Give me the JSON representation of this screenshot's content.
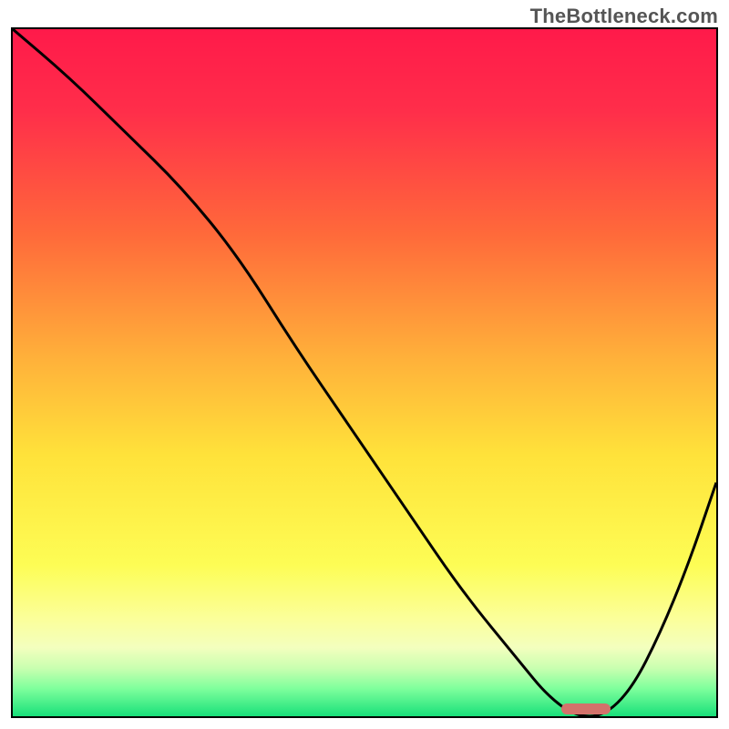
{
  "watermark": "TheBottleneck.com",
  "colors": {
    "gradient_stops": [
      {
        "pct": 0,
        "color": "#ff1a4a"
      },
      {
        "pct": 12,
        "color": "#ff2e4a"
      },
      {
        "pct": 30,
        "color": "#ff6a3a"
      },
      {
        "pct": 48,
        "color": "#ffb13a"
      },
      {
        "pct": 62,
        "color": "#ffe23a"
      },
      {
        "pct": 78,
        "color": "#fdfd55"
      },
      {
        "pct": 86,
        "color": "#fbff9c"
      },
      {
        "pct": 90,
        "color": "#f3ffbe"
      },
      {
        "pct": 93,
        "color": "#c9ffb0"
      },
      {
        "pct": 96,
        "color": "#7eff9c"
      },
      {
        "pct": 100,
        "color": "#18e07a"
      }
    ],
    "curve_stroke": "#000000",
    "marker_fill": "#d3726b"
  },
  "chart_data": {
    "type": "line",
    "title": "",
    "xlabel": "",
    "ylabel": "",
    "xlim": [
      0,
      100
    ],
    "ylim": [
      0,
      100
    ],
    "series": [
      {
        "name": "curve",
        "x": [
          0,
          8,
          16,
          24,
          32,
          40,
          48,
          56,
          64,
          72,
          76,
          80,
          84,
          88,
          92,
          96,
          100
        ],
        "y": [
          100,
          93,
          85,
          77,
          67,
          54,
          42,
          30,
          18,
          8,
          3,
          0,
          0,
          4,
          12,
          22,
          34
        ]
      }
    ],
    "marker": {
      "x_start": 78,
      "x_end": 85,
      "y": 0
    }
  }
}
